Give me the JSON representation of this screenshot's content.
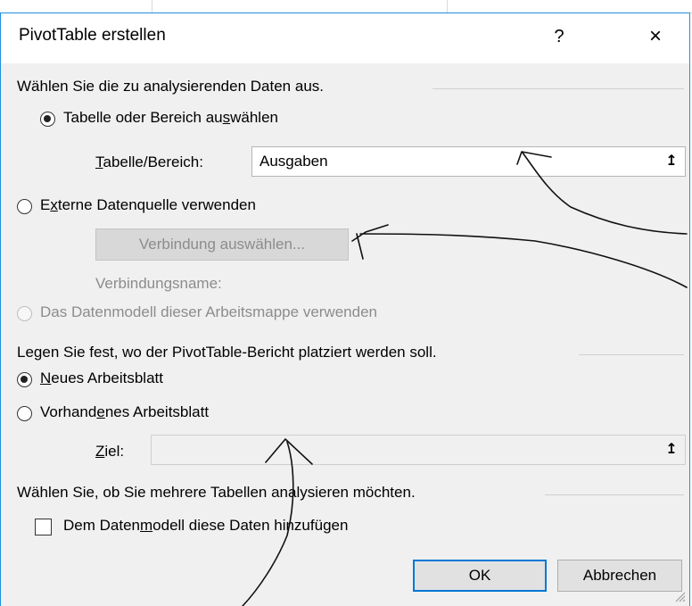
{
  "dialog": {
    "title": "PivotTable erstellen",
    "help_label": "?",
    "close_label": "×"
  },
  "section1": {
    "heading": "Wählen Sie die zu analysierenden Daten aus.",
    "option_table_pre": "Tabelle oder Bereich au",
    "option_table_u": "s",
    "option_table_post": "wählen",
    "range_label_u": "T",
    "range_label_post": "abelle/Bereich:",
    "range_value": "Ausgaben",
    "option_external_pre": "E",
    "option_external_u": "x",
    "option_external_post": "terne Datenquelle verwenden",
    "connection_button": "Verbindung auswählen...",
    "connection_name_label": "Verbindungsname:",
    "option_datamodel": "Das Datenmodell dieser Arbeitsmappe verwenden"
  },
  "section2": {
    "heading": "Legen Sie fest, wo der PivotTable-Bericht platziert werden soll.",
    "option_new_u": "N",
    "option_new_post": "eues Arbeitsblatt",
    "option_existing_pre": "Vorhand",
    "option_existing_u": "e",
    "option_existing_post": "nes Arbeitsblatt",
    "target_label_u": "Z",
    "target_label_post": "iel:",
    "target_value": ""
  },
  "section3": {
    "heading": "Wählen Sie, ob Sie mehrere Tabellen analysieren möchten.",
    "checkbox_pre": "Dem Daten",
    "checkbox_u": "m",
    "checkbox_post": "odell diese Daten hinzufügen"
  },
  "buttons": {
    "ok": "OK",
    "cancel": "Abbrechen"
  },
  "icons": {
    "collapse": "↥"
  },
  "colors": {
    "dialog_border": "#1e90e0",
    "dialog_bg": "#f0f0f0",
    "primary_border": "#0078d7"
  }
}
